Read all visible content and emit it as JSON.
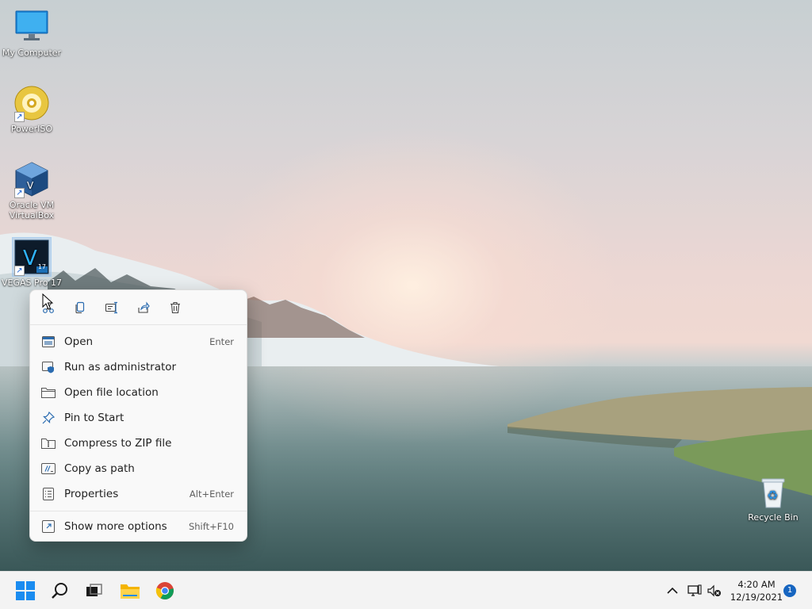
{
  "desktop": {
    "icons": [
      {
        "label": "My Computer"
      },
      {
        "label": "PowerISO"
      },
      {
        "label": "Oracle VM VirtualBox"
      },
      {
        "label": "VEGAS Pro 17",
        "badge": "17"
      },
      {
        "label": "Recycle Bin"
      }
    ]
  },
  "context_menu": {
    "quick_actions": [
      "cut-icon",
      "copy-icon",
      "rename-icon",
      "share-icon",
      "delete-icon"
    ],
    "items": [
      {
        "label": "Open",
        "shortcut": "Enter",
        "icon": "open-window-icon"
      },
      {
        "label": "Run as administrator",
        "shortcut": "",
        "icon": "shield-icon"
      },
      {
        "label": "Open file location",
        "shortcut": "",
        "icon": "folder-icon"
      },
      {
        "label": "Pin to Start",
        "shortcut": "",
        "icon": "pin-icon"
      },
      {
        "label": "Compress to ZIP file",
        "shortcut": "",
        "icon": "zip-icon"
      },
      {
        "label": "Copy as path",
        "shortcut": "",
        "icon": "path-icon"
      },
      {
        "label": "Properties",
        "shortcut": "Alt+Enter",
        "icon": "properties-icon"
      },
      {
        "label": "Show more options",
        "shortcut": "Shift+F10",
        "icon": "more-options-icon"
      }
    ]
  },
  "taskbar": {
    "clock": {
      "time": "4:20 AM",
      "date": "12/19/2021"
    },
    "notification_count": "1"
  },
  "colors": {
    "accent": "#1665c0",
    "menu_bg": "#f9f9f9",
    "taskbar_bg": "#f3f3f3"
  }
}
